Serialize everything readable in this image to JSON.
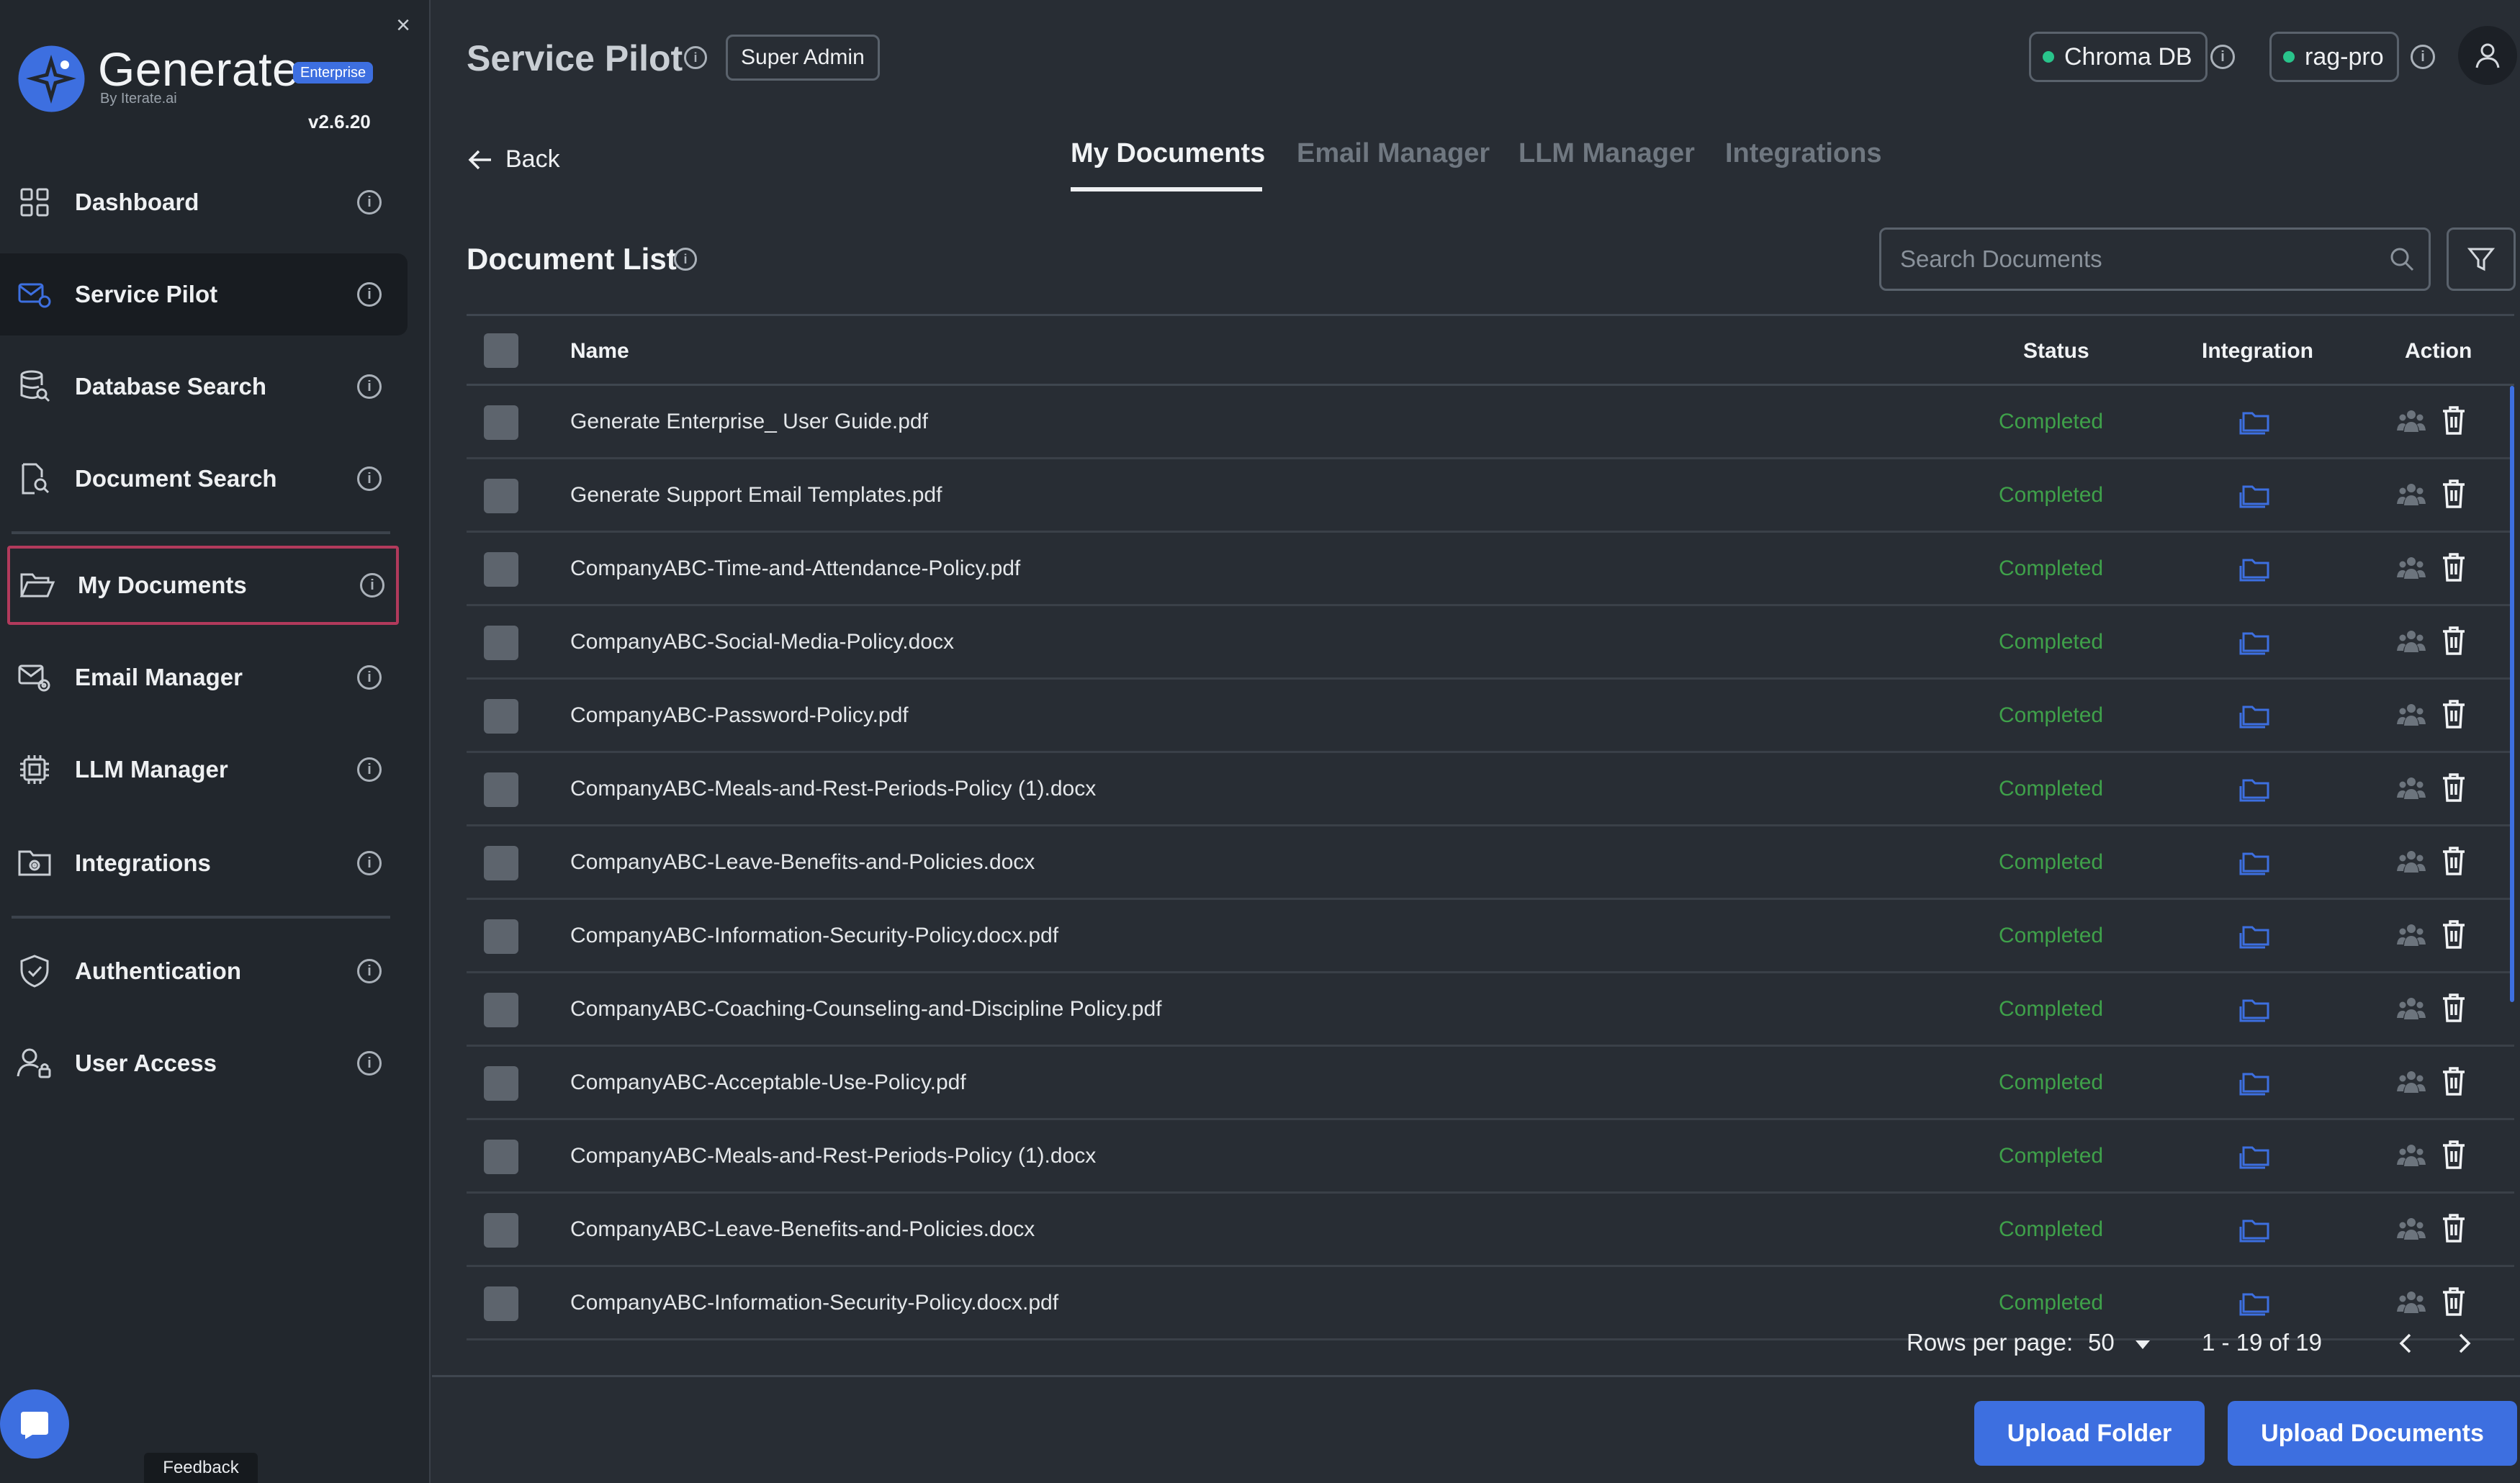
{
  "app": {
    "name": "Generate",
    "edition": "Enterprise",
    "byline": "By Iterate.ai",
    "version": "v2.6.20"
  },
  "sidebar": {
    "items": [
      {
        "label": "Dashboard",
        "icon": "dashboard-icon"
      },
      {
        "label": "Service Pilot",
        "icon": "service-pilot-icon",
        "active": true
      },
      {
        "label": "Database Search",
        "icon": "database-search-icon"
      },
      {
        "label": "Document Search",
        "icon": "document-search-icon"
      },
      {
        "label": "My Documents",
        "icon": "folder-open-icon",
        "highlighted": true
      },
      {
        "label": "Email Manager",
        "icon": "email-settings-icon"
      },
      {
        "label": "LLM Manager",
        "icon": "chip-icon"
      },
      {
        "label": "Integrations",
        "icon": "integrations-folder-icon"
      },
      {
        "label": "Authentication",
        "icon": "shield-check-icon"
      },
      {
        "label": "User Access",
        "icon": "user-lock-icon"
      }
    ],
    "feedback_label": "Feedback"
  },
  "header": {
    "title": "Service Pilot",
    "role": "Super Admin",
    "db_chip": "Chroma DB",
    "model_chip": "rag-pro"
  },
  "nav": {
    "back_label": "Back",
    "tabs": [
      "My Documents",
      "Email Manager",
      "LLM Manager",
      "Integrations"
    ],
    "active_tab": "My Documents"
  },
  "documents": {
    "title": "Document List",
    "search_placeholder": "Search Documents",
    "columns": {
      "name": "Name",
      "status": "Status",
      "integration": "Integration",
      "action": "Action"
    },
    "rows": [
      {
        "name": "Generate Enterprise_ User Guide.pdf",
        "status": "Completed"
      },
      {
        "name": "Generate Support Email Templates.pdf",
        "status": "Completed"
      },
      {
        "name": "CompanyABC-Time-and-Attendance-Policy.pdf",
        "status": "Completed"
      },
      {
        "name": "CompanyABC-Social-Media-Policy.docx",
        "status": "Completed"
      },
      {
        "name": "CompanyABC-Password-Policy.pdf",
        "status": "Completed"
      },
      {
        "name": "CompanyABC-Meals-and-Rest-Periods-Policy (1).docx",
        "status": "Completed"
      },
      {
        "name": "CompanyABC-Leave-Benefits-and-Policies.docx",
        "status": "Completed"
      },
      {
        "name": "CompanyABC-Information-Security-Policy.docx.pdf",
        "status": "Completed"
      },
      {
        "name": "CompanyABC-Coaching-Counseling-and-Discipline Policy.pdf",
        "status": "Completed"
      },
      {
        "name": "CompanyABC-Acceptable-Use-Policy.pdf",
        "status": "Completed"
      },
      {
        "name": "CompanyABC-Meals-and-Rest-Periods-Policy (1).docx",
        "status": "Completed"
      },
      {
        "name": "CompanyABC-Leave-Benefits-and-Policies.docx",
        "status": "Completed"
      },
      {
        "name": "CompanyABC-Information-Security-Policy.docx.pdf",
        "status": "Completed"
      }
    ],
    "pagination": {
      "rows_per_page_label": "Rows per page:",
      "rows_per_page": "50",
      "range": "1 - 19 of 19"
    }
  },
  "actions": {
    "upload_folder": "Upload Folder",
    "upload_documents": "Upload Documents"
  },
  "colors": {
    "accent": "#3d6fe0",
    "status_completed": "#3fa14a",
    "status_dot": "#29c48b",
    "highlight_outline": "#b23a5c"
  }
}
